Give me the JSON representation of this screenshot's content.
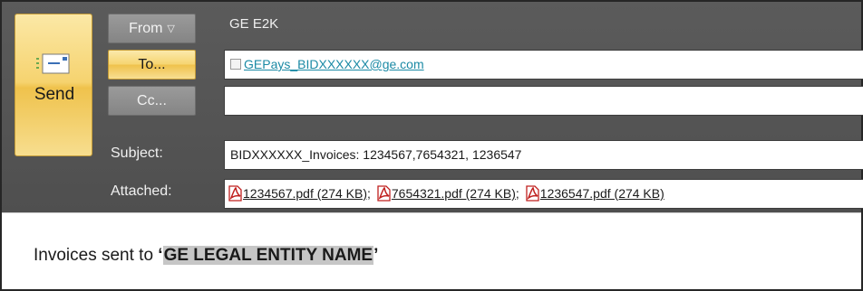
{
  "send": {
    "label": "Send"
  },
  "from": {
    "label": "From",
    "account": "GE E2K"
  },
  "to": {
    "label": "To...",
    "recipient": "GEPays_BIDXXXXXX@ge.com"
  },
  "cc": {
    "label": "Cc...",
    "value": ""
  },
  "subject": {
    "label": "Subject:",
    "value": "BIDXXXXXX_Invoices: 1234567,7654321, 1236547"
  },
  "attached": {
    "label": "Attached:",
    "files": [
      {
        "name": "1234567.pdf (274 KB)"
      },
      {
        "name": "7654321.pdf (274 KB)"
      },
      {
        "name": "1236547.pdf (274 KB)"
      }
    ],
    "separator": ";"
  },
  "body": {
    "prefix": "Invoices sent to ",
    "open_quote": "‘",
    "entity": "GE LEGAL ENTITY NAME",
    "close_quote": "’"
  },
  "colors": {
    "header_bg": "#555555",
    "button_gold": "#f6d36f",
    "button_gray": "#8f8f8f",
    "link": "#1b8aa5",
    "pdf_red": "#c0201f"
  },
  "icons": {
    "send": "envelope-send-icon",
    "attachment": "pdf-file-icon",
    "from_dropdown": "caret-down-icon"
  }
}
